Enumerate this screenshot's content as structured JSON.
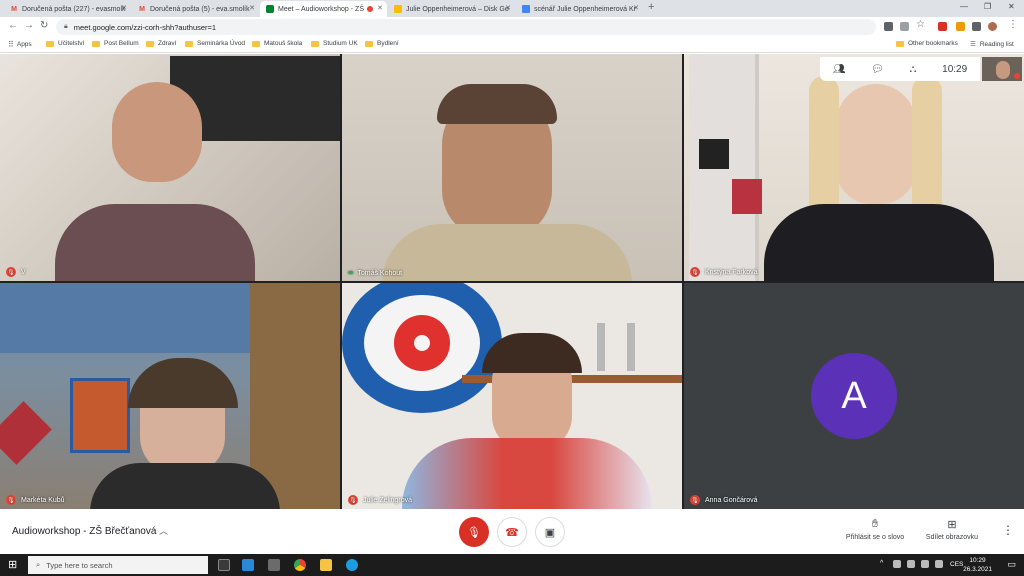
{
  "browser": {
    "tabs": [
      {
        "label": "Doručená pošta (227) - evasmolk"
      },
      {
        "label": "Doručená pošta (5) - eva.smolík"
      },
      {
        "label": "Meet – Audioworkshop - ZŠ"
      },
      {
        "label": "Julie Oppenheimerová – Disk Go"
      },
      {
        "label": "scénář Julie Oppenheimerová Kr"
      }
    ],
    "url": "meet.google.com/zzi-corh-shh?authuser=1",
    "bookmarks": [
      "Apps",
      "Učitelství",
      "Post Bellum",
      "Zdraví",
      "Seminárka Úvod",
      "Matouš škola",
      "Studium UK",
      "Bydlení"
    ],
    "other_bookmarks": "Other bookmarks",
    "reading_list": "Reading list"
  },
  "meet": {
    "time": "10:29",
    "participants": [
      {
        "name": "V"
      },
      {
        "name": "Tomáš Kohout"
      },
      {
        "name": "Kristýna Farková"
      },
      {
        "name": "Markéta Kubů"
      },
      {
        "name": "Julie Zelingrová"
      },
      {
        "name": "Anna Gončárová",
        "initial": "A"
      }
    ],
    "meeting_title": "Audioworkshop - ZŠ Břečťanová",
    "raise_hand_label": "Přihlásit se o slovo",
    "share_screen_label": "Sdílet obrazovku"
  },
  "taskbar": {
    "search_placeholder": "Type here to search",
    "language": "CES",
    "clock_time": "10:29",
    "clock_date": "26.3.2021"
  }
}
